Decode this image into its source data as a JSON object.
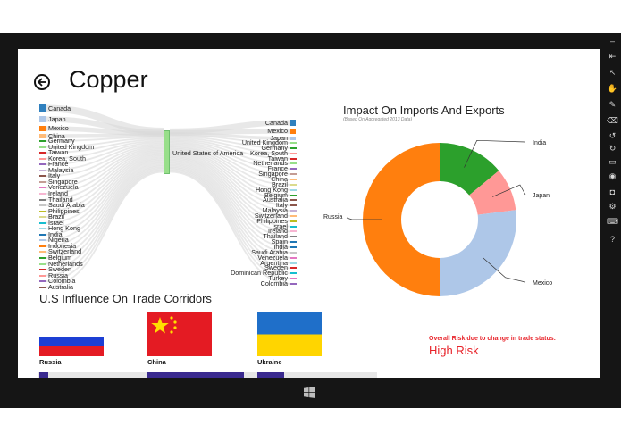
{
  "page": {
    "title": "Copper"
  },
  "sankey": {
    "left_countries": [
      {
        "name": "Canada",
        "color": "#2f80be"
      },
      {
        "name": "Japan",
        "color": "#aec7e8"
      },
      {
        "name": "Mexico",
        "color": "#ff7f0e"
      },
      {
        "name": "China",
        "color": "#ffbb78"
      },
      {
        "name": "Germany",
        "color": "#2ca02c"
      },
      {
        "name": "United Kingdom",
        "color": "#98df8a"
      },
      {
        "name": "Taiwan",
        "color": "#d62728"
      },
      {
        "name": "Korea, South",
        "color": "#ff9896"
      },
      {
        "name": "France",
        "color": "#9467bd"
      },
      {
        "name": "Malaysia",
        "color": "#c5b0d5"
      },
      {
        "name": "Italy",
        "color": "#8c564b"
      },
      {
        "name": "Singapore",
        "color": "#c49c94"
      },
      {
        "name": "Venezuela",
        "color": "#e377c2"
      },
      {
        "name": "Ireland",
        "color": "#f7b6d2"
      },
      {
        "name": "Thailand",
        "color": "#7f7f7f"
      },
      {
        "name": "Saudi Arabia",
        "color": "#c7c7c7"
      },
      {
        "name": "Philippines",
        "color": "#bcbd22"
      },
      {
        "name": "Brazil",
        "color": "#dbdb8d"
      },
      {
        "name": "Israel",
        "color": "#17becf"
      },
      {
        "name": "Hong Kong",
        "color": "#9edae5"
      },
      {
        "name": "India",
        "color": "#1f77b4"
      },
      {
        "name": "Nigeria",
        "color": "#aec7e8"
      },
      {
        "name": "Indonesia",
        "color": "#ff7f0e"
      },
      {
        "name": "Switzerland",
        "color": "#ffbb78"
      },
      {
        "name": "Belgium",
        "color": "#2ca02c"
      },
      {
        "name": "Netherlands",
        "color": "#98df8a"
      },
      {
        "name": "Sweden",
        "color": "#d62728"
      },
      {
        "name": "Russia",
        "color": "#ff9896"
      },
      {
        "name": "Colombia",
        "color": "#9467bd"
      },
      {
        "name": "Australia",
        "color": "#8c564b"
      }
    ],
    "center_label": "United States of America",
    "right_countries": [
      {
        "name": "Canada",
        "color": "#2f80be"
      },
      {
        "name": "Mexico",
        "color": "#ff7f0e"
      },
      {
        "name": "Japan",
        "color": "#aec7e8"
      },
      {
        "name": "United Kingdom",
        "color": "#98df8a"
      },
      {
        "name": "Germany",
        "color": "#2ca02c"
      },
      {
        "name": "Korea, South",
        "color": "#ff9896"
      },
      {
        "name": "Taiwan",
        "color": "#d62728"
      },
      {
        "name": "Netherlands",
        "color": "#98df8a"
      },
      {
        "name": "France",
        "color": "#9467bd"
      },
      {
        "name": "Singapore",
        "color": "#c49c94"
      },
      {
        "name": "China",
        "color": "#ffbb78"
      },
      {
        "name": "Brazil",
        "color": "#dbdb8d"
      },
      {
        "name": "Hong Kong",
        "color": "#9edae5"
      },
      {
        "name": "Belgium",
        "color": "#2ca02c"
      },
      {
        "name": "Australia",
        "color": "#8c564b"
      },
      {
        "name": "Italy",
        "color": "#8c564b"
      },
      {
        "name": "Malaysia",
        "color": "#c5b0d5"
      },
      {
        "name": "Switzerland",
        "color": "#ffbb78"
      },
      {
        "name": "Philippines",
        "color": "#bcbd22"
      },
      {
        "name": "Israel",
        "color": "#17becf"
      },
      {
        "name": "Ireland",
        "color": "#f7b6d2"
      },
      {
        "name": "Thailand",
        "color": "#7f7f7f"
      },
      {
        "name": "Spain",
        "color": "#1f77b4"
      },
      {
        "name": "India",
        "color": "#1f77b4"
      },
      {
        "name": "Saudi Arabia",
        "color": "#c7c7c7"
      },
      {
        "name": "Venezuela",
        "color": "#e377c2"
      },
      {
        "name": "Argentina",
        "color": "#9edae5"
      },
      {
        "name": "Sweden",
        "color": "#d62728"
      },
      {
        "name": "Dominican Republic",
        "color": "#17becf"
      },
      {
        "name": "Turkey",
        "color": "#e377c2"
      },
      {
        "name": "Colombia",
        "color": "#9467bd"
      }
    ],
    "link_color": "#d9d9d9",
    "center_color": "#98df8a"
  },
  "corridors": {
    "title": "U.S Influence On Trade Corridors",
    "flags": [
      {
        "name": "Russia"
      },
      {
        "name": "China"
      },
      {
        "name": "Ukraine"
      }
    ]
  },
  "chart_data": {
    "type": "pie",
    "title": "Impact On Imports And Exports",
    "subtitle": "(Based On Aggregated 2013 Data)",
    "categories": [
      "India",
      "Japan",
      "Mexico",
      "Russia"
    ],
    "values": [
      14,
      9,
      27,
      50
    ],
    "colors": [
      "#2ca02c",
      "#ff9896",
      "#aec7e8",
      "#ff7f0e"
    ],
    "donut": true
  },
  "risk": {
    "label": "Overall Risk due to change in trade status:",
    "value": "High Risk"
  },
  "charms_icons": [
    "minimize-icon",
    "pin-icon",
    "pointer-icon",
    "hand-icon",
    "pen-icon",
    "eraser-icon",
    "rotate-left-icon",
    "rotate-right-icon",
    "screen-icon",
    "record-icon",
    "camera-icon",
    "settings-icon",
    "keyboard-icon",
    "help-icon"
  ]
}
